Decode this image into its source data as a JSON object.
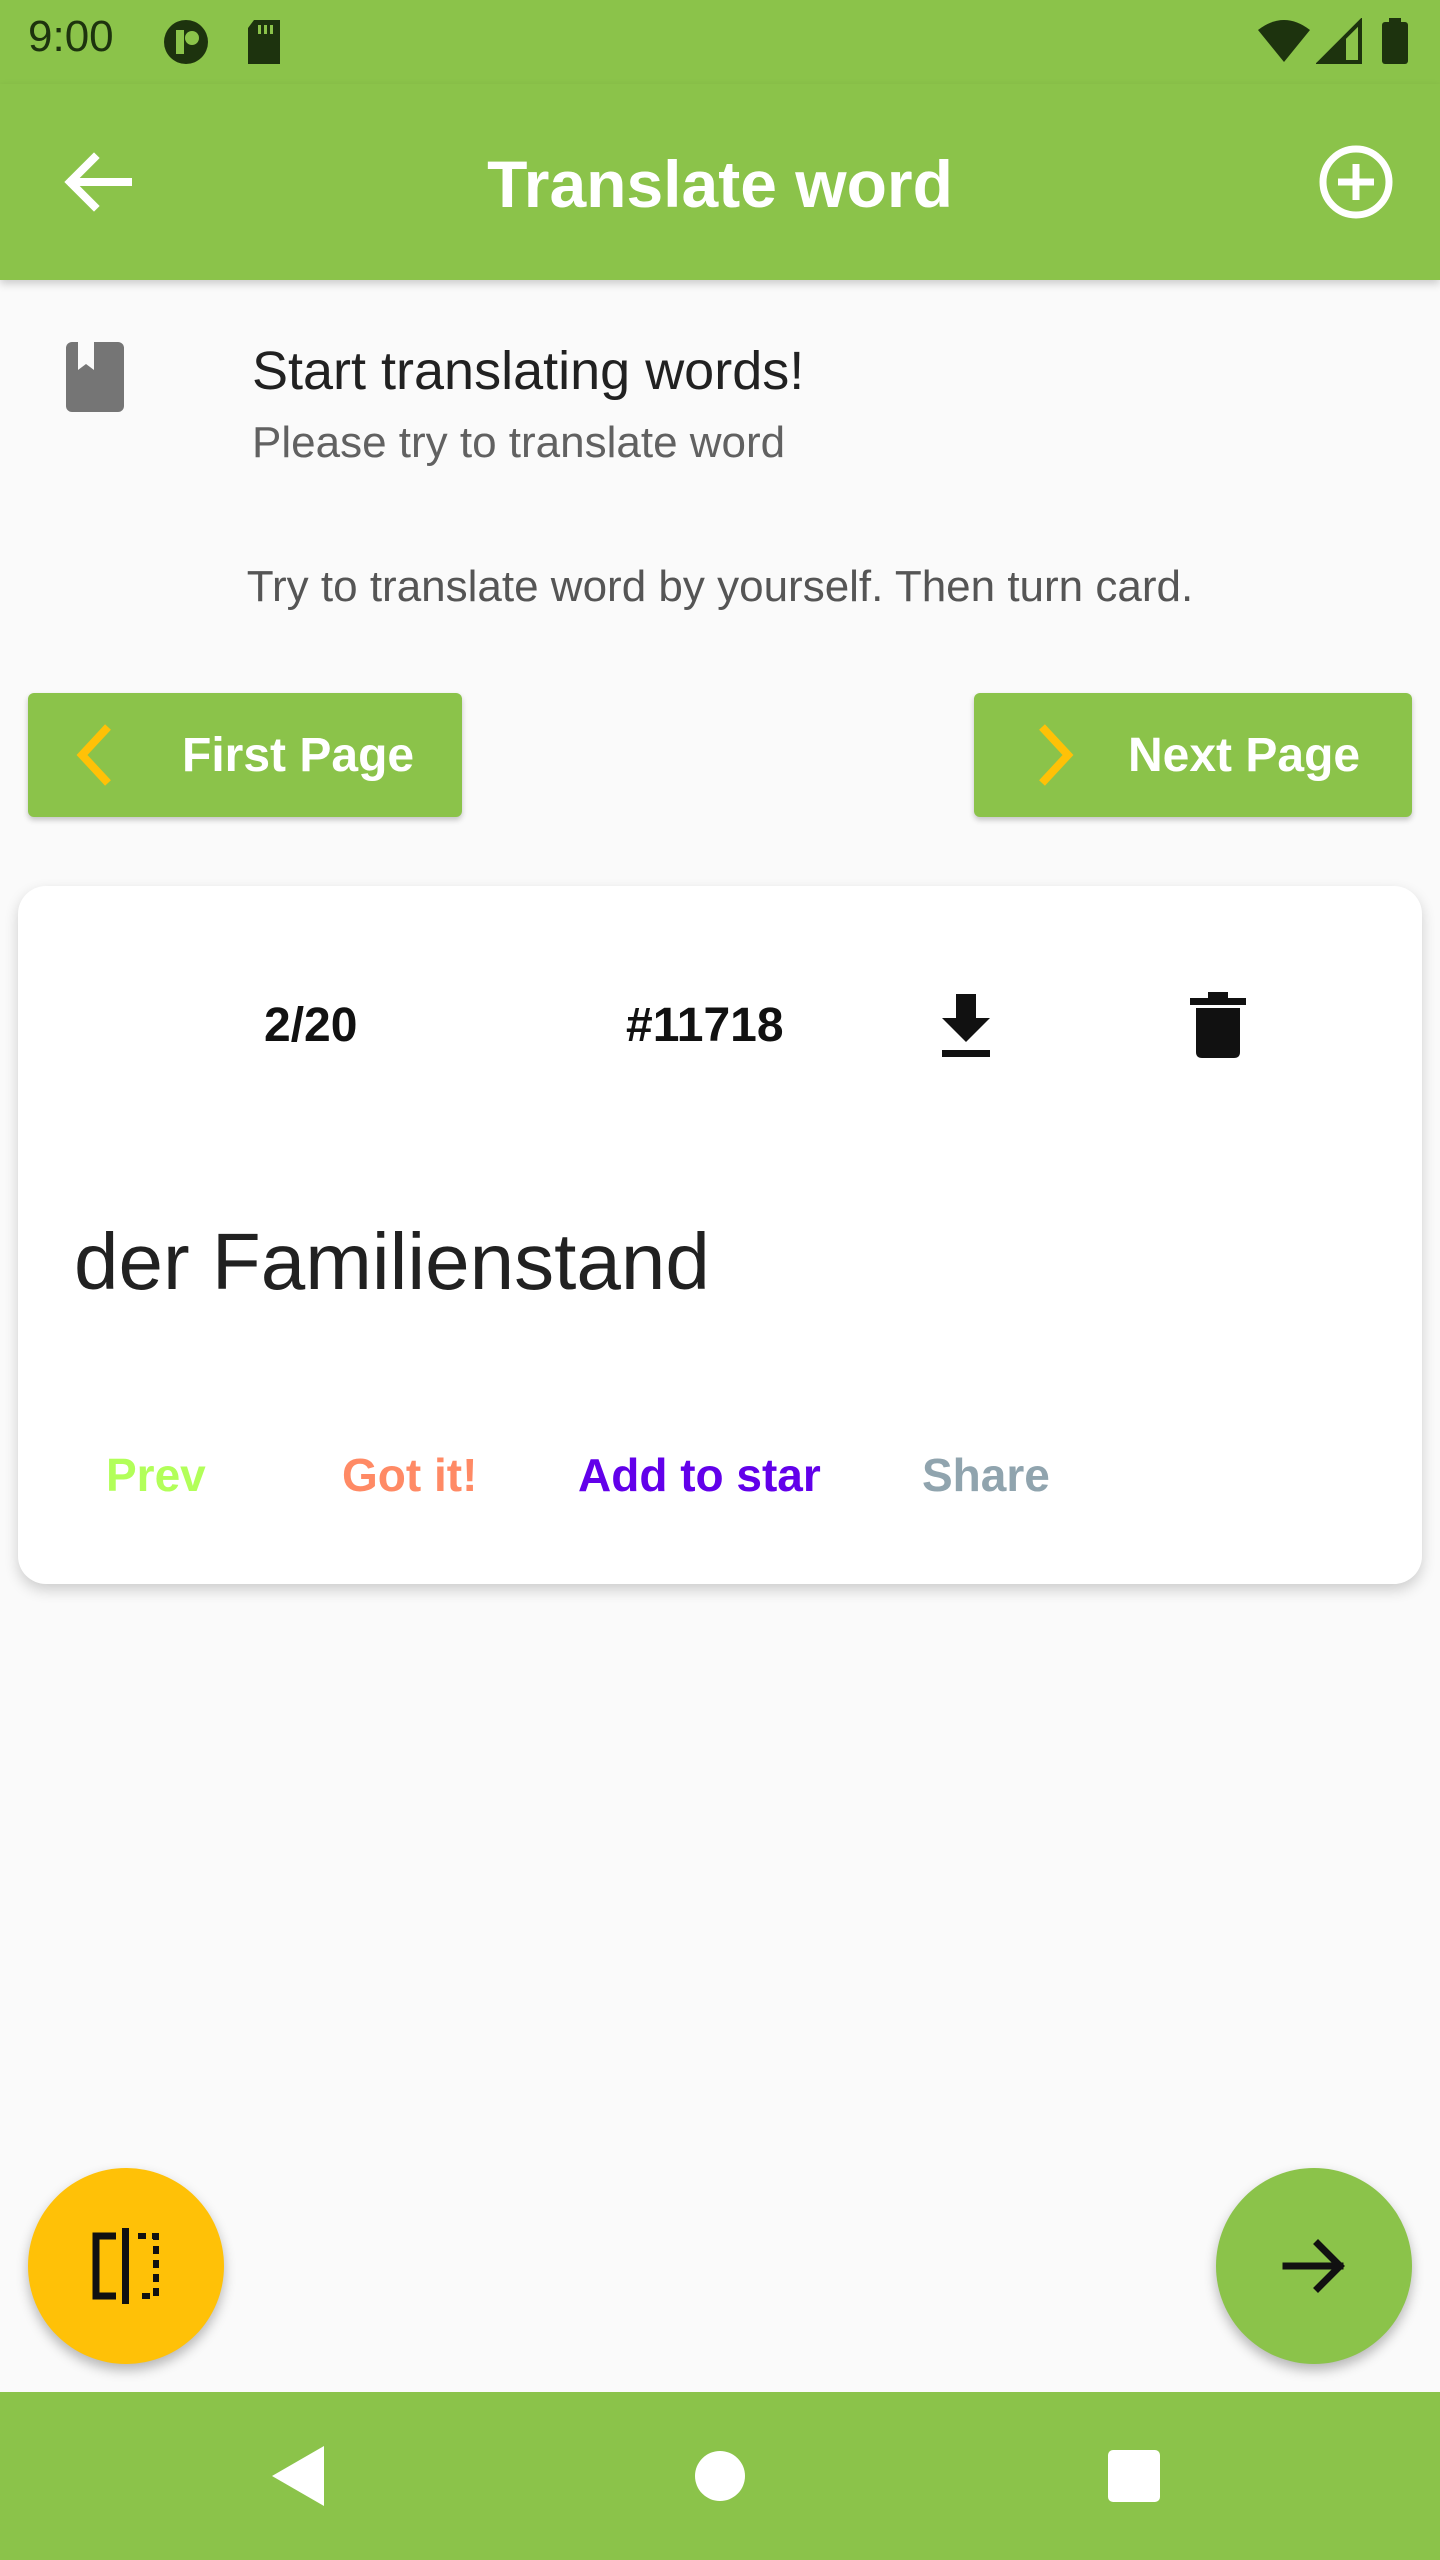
{
  "status_bar": {
    "time": "9:00",
    "icons": [
      "brand-circle-icon",
      "sd-card-icon",
      "wifi-icon",
      "cell-signal-icon",
      "battery-icon"
    ]
  },
  "app_bar": {
    "title": "Translate word",
    "back_icon": "arrow-back-icon",
    "add_icon": "add-circle-icon"
  },
  "intro": {
    "icon": "bookmark-book-icon",
    "title": "Start translating words!",
    "subtitle": "Please try to translate word"
  },
  "hint": "Try to translate word by yourself. Then turn card.",
  "pagination": {
    "first_label": "First Page",
    "next_label": "Next Page"
  },
  "card": {
    "counter": "2/20",
    "id": "#11718",
    "word": "der Familienstand",
    "actions": {
      "prev": "Prev",
      "got_it": "Got it!",
      "add_to_star": "Add to star",
      "share": "Share"
    }
  },
  "fabs": {
    "flip_icon": "flip-icon",
    "next_icon": "arrow-forward-icon"
  },
  "system_nav": {
    "back_icon": "nav-back-icon",
    "home_icon": "nav-home-icon",
    "recents_icon": "nav-recents-icon"
  },
  "colors": {
    "primary": "#8bc34a",
    "accent": "#ffc107",
    "prev": "#b2ff59",
    "got_it": "#ff8a65",
    "add_to_star": "#6200ea",
    "share": "#90a4ae"
  }
}
